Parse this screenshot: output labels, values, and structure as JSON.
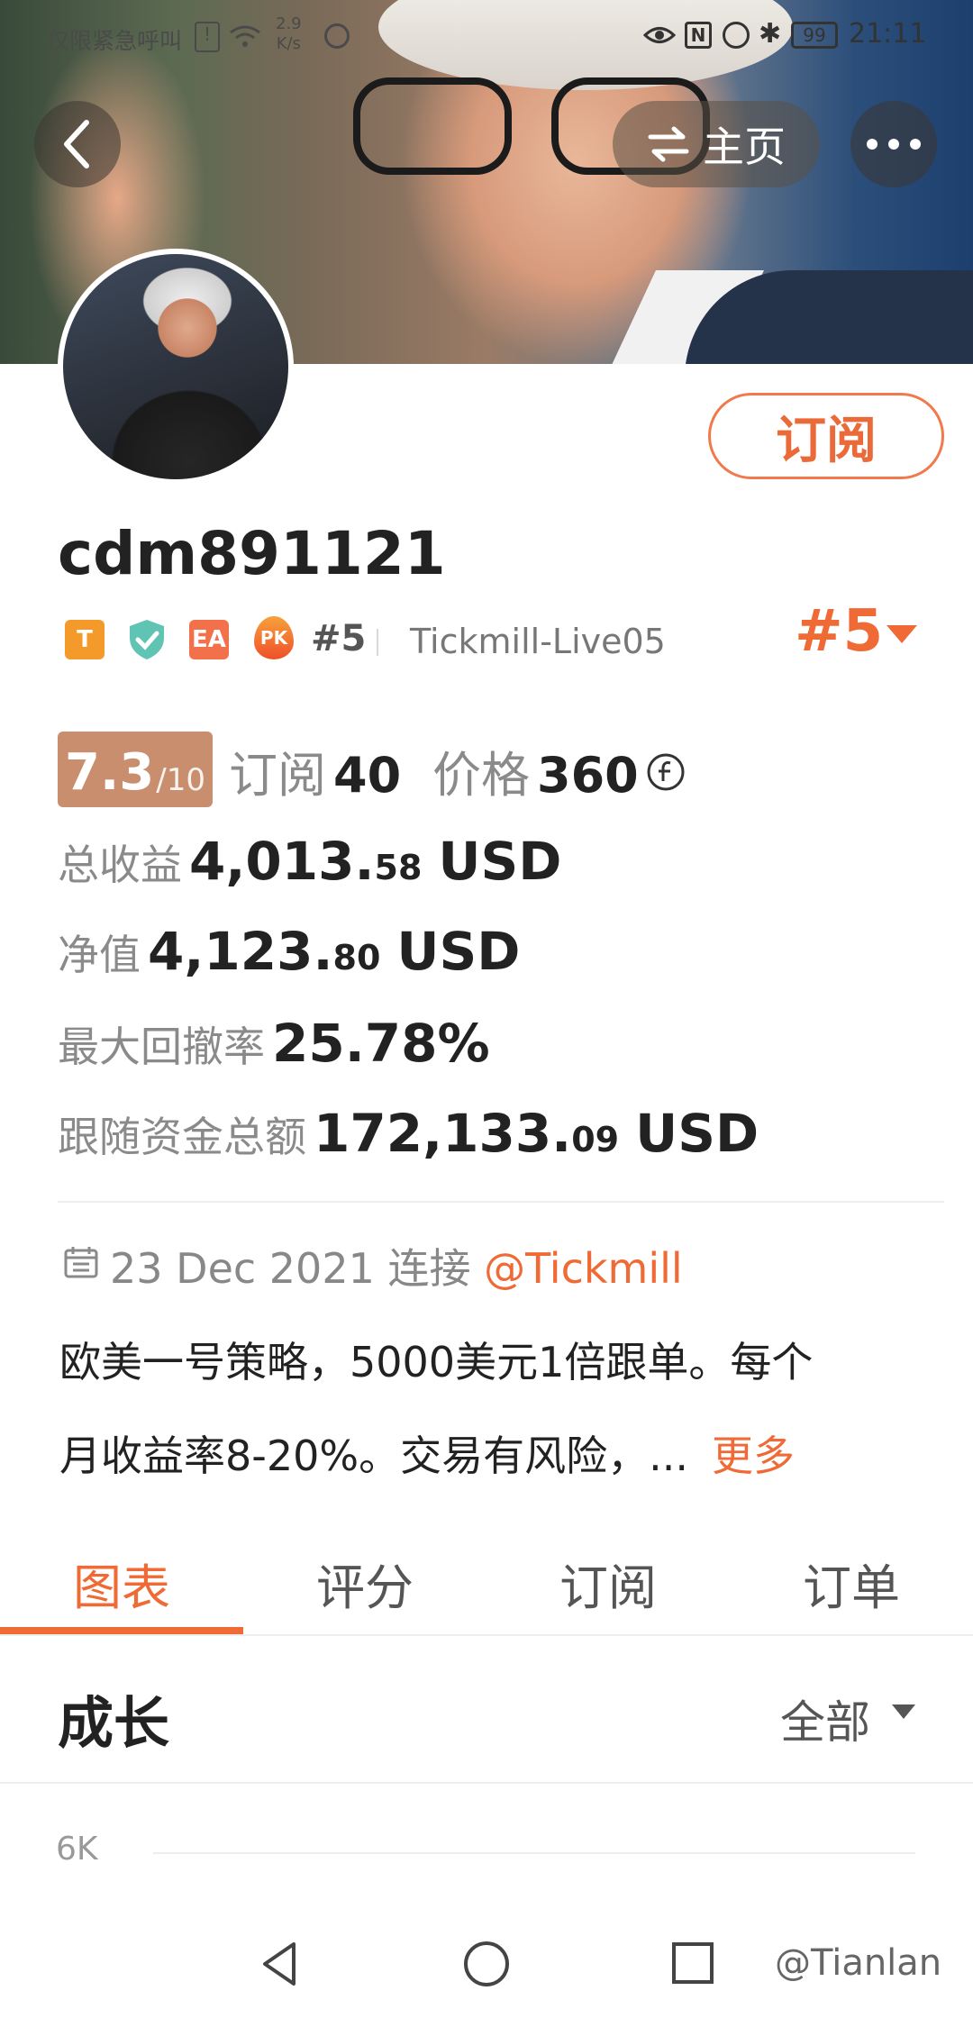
{
  "status_bar": {
    "left_text": "仅限紧急呼叫",
    "speed_value": "2.9",
    "speed_unit": "K/s",
    "battery": "99",
    "time": "21:11"
  },
  "header": {
    "home_label": "主页",
    "icons": {
      "back": "back-icon",
      "swap": "swap-icon",
      "more": "more-icon"
    }
  },
  "profile": {
    "subscribe_label": "订阅",
    "username": "cdm891121",
    "badges": [
      "T",
      "EA",
      "PK"
    ],
    "rank_small": "#5",
    "server": "Tickmill-Live05",
    "rank_big": "#5"
  },
  "stats": {
    "score": "7.3",
    "score_max": "/10",
    "subscriptions_label": "订阅",
    "subscriptions_value": "40",
    "price_label": "价格",
    "price_value": "360",
    "total_profit_label": "总收益",
    "total_profit_int": "4,013.",
    "total_profit_dec": "58",
    "total_profit_unit": "USD",
    "equity_label": "净值",
    "equity_int": "4,123.",
    "equity_dec": "80",
    "equity_unit": "USD",
    "drawdown_label": "最大回撤率",
    "drawdown_value": "25.78%",
    "follow_label": "跟随资金总额",
    "follow_int": "172,133.",
    "follow_dec": "09",
    "follow_unit": "USD"
  },
  "info": {
    "date": "23 Dec 2021",
    "connect_label": "连接",
    "broker_link": "@Tickmill",
    "desc_line1": "欧美一号策略，5000美元1倍跟单。每个",
    "desc_line2": "月收益率8-20%。交易有风险，...",
    "more_label": "更多"
  },
  "tabs": [
    "图表",
    "评分",
    "订阅",
    "订单"
  ],
  "chart_section": {
    "title": "成长",
    "filter": "全部",
    "y_tick": "6K"
  },
  "watermark": "@Tianlan",
  "colors": {
    "accent": "#ef6a35",
    "score_bg": "#c98e6e"
  }
}
